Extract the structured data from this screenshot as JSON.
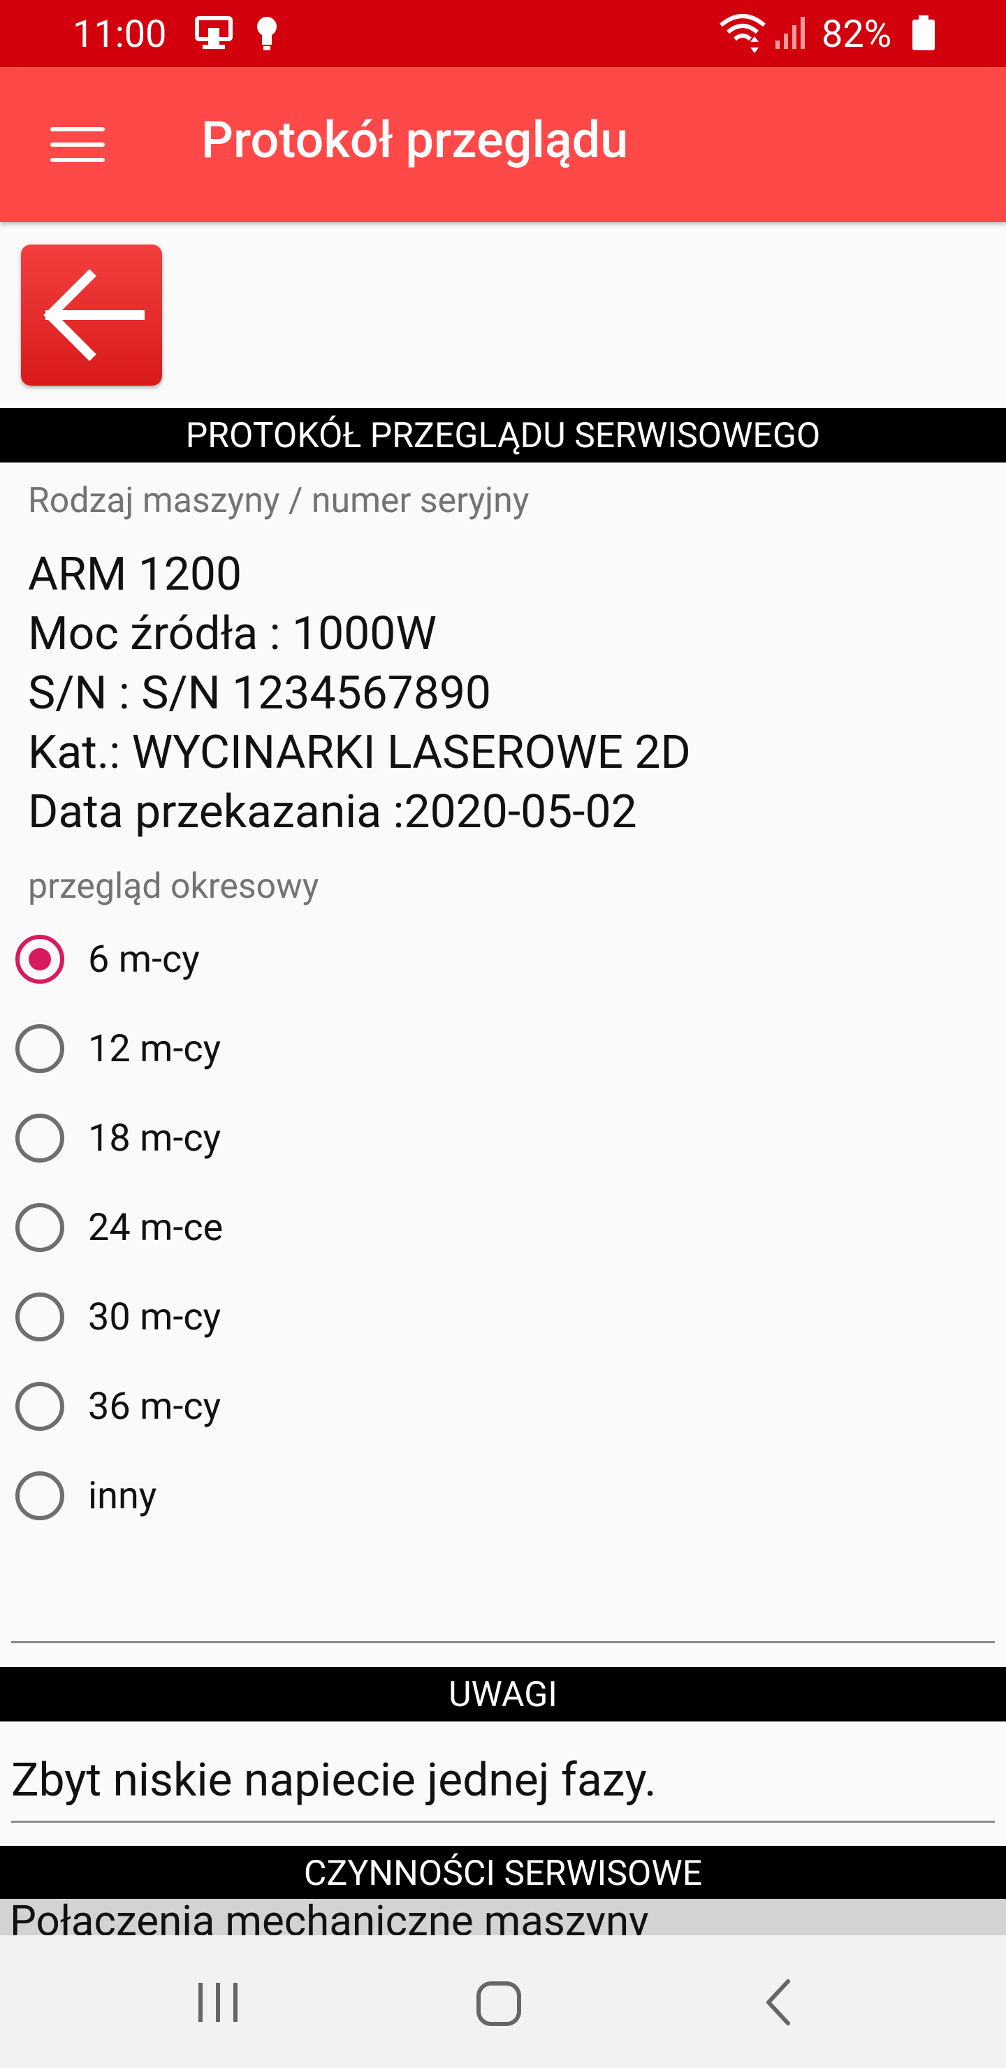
{
  "status_bar": {
    "time": "11:00",
    "battery": "82%",
    "icons": [
      "nfc-icon",
      "lightbulb-icon",
      "wifi-icon",
      "signal-icon",
      "battery-icon"
    ]
  },
  "app_bar": {
    "title": "Protokół przeglądu",
    "menu_icon": "hamburger-menu-icon"
  },
  "back_button": {
    "icon": "arrow-left-icon",
    "color": "#e82828"
  },
  "header": {
    "title": "PROTOKÓŁ PRZEGLĄDU SERWISOWEGO"
  },
  "machine": {
    "label": "Rodzaj maszyny / numer seryjny",
    "lines": [
      "ARM 1200",
      "Moc źródła : 1000W",
      "S/N : S/N 1234567890",
      "Kat.: WYCINARKI LASEROWE 2D",
      "Data przekazania :2020-05-02"
    ]
  },
  "inspection": {
    "label": "przegląd okresowy",
    "selected": "6 m-cy",
    "options": [
      "6 m-cy",
      "12 m-cy",
      "18 m-cy",
      "24 m-ce",
      "30 m-cy",
      "36 m-cy",
      "inny"
    ]
  },
  "notes": {
    "header": "UWAGI",
    "value": "Zbyt niskie napiecie jednej fazy."
  },
  "services": {
    "header": "CZYNNOŚCI SERWISOWE",
    "first_item": "Połączenia mechaniczne maszyny"
  },
  "nav_bar": {
    "icons": [
      "recent-apps-icon",
      "home-icon",
      "back-icon"
    ]
  },
  "colors": {
    "status_bar": "#d1000c",
    "app_bar": "#ff4848",
    "accent_radio": "#d81b60",
    "section_header": "#000000"
  }
}
